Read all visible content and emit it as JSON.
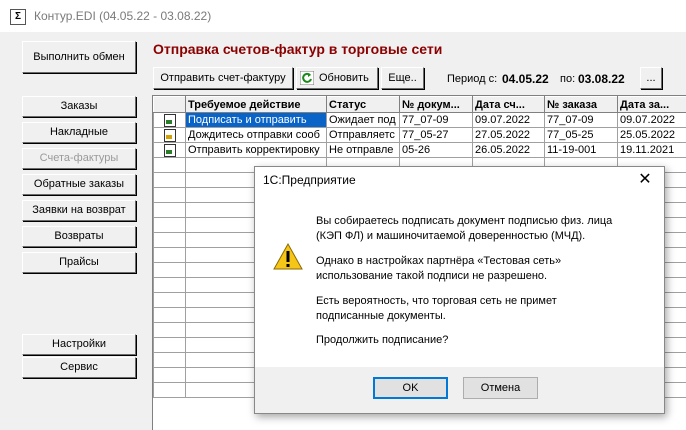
{
  "window": {
    "title": "Контур.EDI (04.05.22 - 03.08.22)",
    "app_icon": "Σ"
  },
  "sidebar": {
    "exchange_label": "Выполнить обмен",
    "items": [
      "Заказы",
      "Накладные",
      "Счета-фактуры",
      "Обратные заказы",
      "Заявки на возврат",
      "Возвраты",
      "Прайсы"
    ],
    "active_item": "Счета-фактуры",
    "bottom_items": [
      "Настройки",
      "Сервис"
    ]
  },
  "header": {
    "title": "Отправка счетов-фактур в торговые сети",
    "send_label": "Отправить счет-фактуру",
    "refresh_label": "Обновить",
    "more_label": "Еще..",
    "period_from_label": "Период с:",
    "period_from": "04.05.22",
    "period_to_label": "по:",
    "period_to": "03.08.22",
    "period_button": "..."
  },
  "table": {
    "columns": [
      "",
      "Требуемое действие",
      "Статус",
      "№ докум...",
      "Дата сч...",
      "№ заказа",
      "Дата за..."
    ],
    "rows": [
      {
        "icon": "document-green-icon",
        "action": "Подписать и отправить",
        "status": "Ожидает под",
        "doc": "77_07-09",
        "doc_date": "09.07.2022",
        "order": "77_07-09",
        "order_date": "09.07.2022"
      },
      {
        "icon": "document-yellow-icon",
        "action": "Дождитесь отправки сооб",
        "status": "Отправляетс",
        "doc": "77_05-27",
        "doc_date": "27.05.2022",
        "order": "77_05-25",
        "order_date": "25.05.2022"
      },
      {
        "icon": "document-green-icon",
        "action": "Отправить корректировку",
        "status": "Не отправле",
        "doc": "05-26",
        "doc_date": "26.05.2022",
        "order": "11-19-001",
        "order_date": "19.11.2021"
      }
    ]
  },
  "dialog": {
    "title": "1С:Предприятие",
    "icon": "warning-icon",
    "lines1": [
      "Вы собираетесь подписать документ подписью физ. лица",
      "(КЭП ФЛ) и машиночитаемой доверенностью (МЧД)."
    ],
    "lines2": [
      "Однако в настройках партнёра «Тестовая сеть»",
      "использование такой подписи не разрешено."
    ],
    "lines3": [
      "Есть вероятность, что торговая сеть не примет",
      "подписанные документы."
    ],
    "question": "Продолжить подписание?",
    "ok_label": "OK",
    "cancel_label": "Отмена"
  }
}
